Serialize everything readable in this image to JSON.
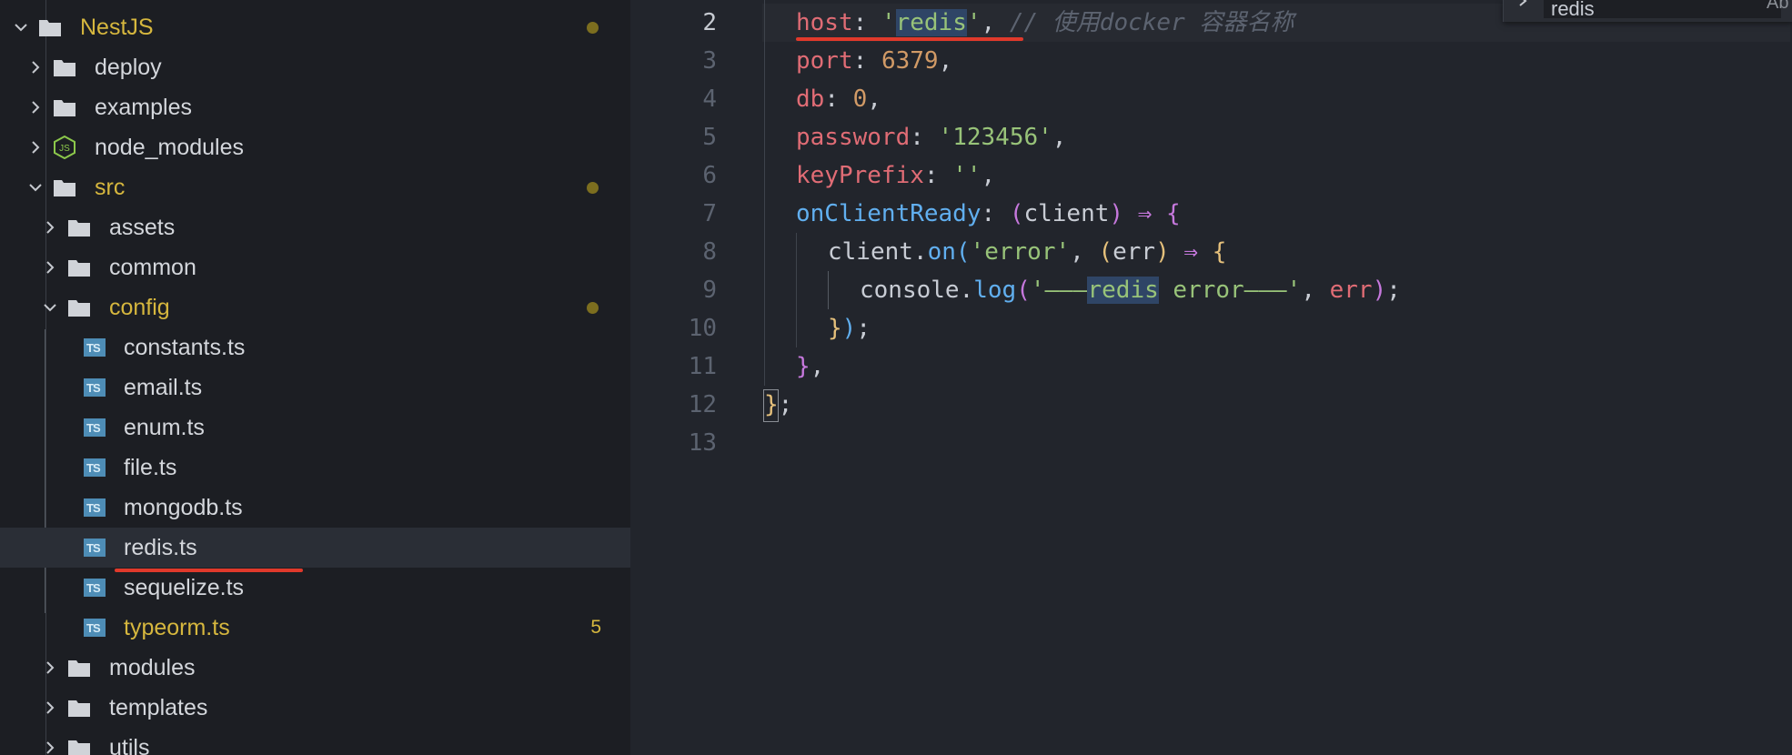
{
  "explorer": {
    "items": [
      {
        "label": "NestJS",
        "modified": true,
        "badge": "dot"
      },
      {
        "label": "deploy"
      },
      {
        "label": "examples"
      },
      {
        "label": "node_modules"
      },
      {
        "label": "src",
        "modified": true,
        "badge": "dot"
      },
      {
        "label": "assets"
      },
      {
        "label": "common"
      },
      {
        "label": "config",
        "modified": true,
        "badge": "dot"
      },
      {
        "label": "constants.ts"
      },
      {
        "label": "email.ts"
      },
      {
        "label": "enum.ts"
      },
      {
        "label": "file.ts"
      },
      {
        "label": "mongodb.ts"
      },
      {
        "label": "redis.ts",
        "selected": true
      },
      {
        "label": "sequelize.ts"
      },
      {
        "label": "typeorm.ts",
        "modified": true,
        "count": "5"
      },
      {
        "label": "modules"
      },
      {
        "label": "templates"
      },
      {
        "label": "utils"
      }
    ]
  },
  "editor": {
    "line_numbers": [
      "2",
      "3",
      "4",
      "5",
      "6",
      "7",
      "8",
      "9",
      "10",
      "11",
      "12",
      "13"
    ],
    "code": {
      "l2_key": "host",
      "l2_colon": ": ",
      "l2_q1": "'",
      "l2_val": "redis",
      "l2_q2": "'",
      "l2_comma": ", ",
      "l2_comment": "// 使用docker 容器名称",
      "l3_key": "port",
      "l3_colon": ": ",
      "l3_val": "6379",
      "l3_comma": ",",
      "l4_key": "db",
      "l4_colon": ": ",
      "l4_val": "0",
      "l4_comma": ",",
      "l5_key": "password",
      "l5_colon": ": ",
      "l5_val": "'123456'",
      "l5_comma": ",",
      "l6_key": "keyPrefix",
      "l6_colon": ": ",
      "l6_val": "''",
      "l6_comma": ",",
      "l7_key": "onClientReady",
      "l7_colon": ": ",
      "l7_po": "(",
      "l7_param": "client",
      "l7_pc": ")",
      "l7_arrow": " ⇒ ",
      "l7_brace": "{",
      "l8_obj": "client",
      "l8_dot": ".",
      "l8_fn": "on",
      "l8_po": "(",
      "l8_str": "'error'",
      "l8_comma": ", ",
      "l8_ppo": "(",
      "l8_param": "err",
      "l8_ppc": ")",
      "l8_arrow": " ⇒ ",
      "l8_brace": "{",
      "l9_obj": "console",
      "l9_dot": ".",
      "l9_fn": "log",
      "l9_po": "(",
      "l9_str1": "'———",
      "l9_str_hl": "redis",
      "l9_str2": " error———'",
      "l9_comma": ", ",
      "l9_arg": "err",
      "l9_pc": ")",
      "l9_semi": ";",
      "l10_brace": "}",
      "l10_pc": ")",
      "l10_semi": ";",
      "l11_brace": "}",
      "l11_comma": ",",
      "l12_brace": "}",
      "l12_semi": ";"
    }
  },
  "find": {
    "value": "redis",
    "option": "Ab"
  },
  "colors": {
    "modified": "#d6b73e",
    "underline": "#e0392b",
    "ts_icon": "#4e8db6",
    "selection": "#2a2e36"
  }
}
